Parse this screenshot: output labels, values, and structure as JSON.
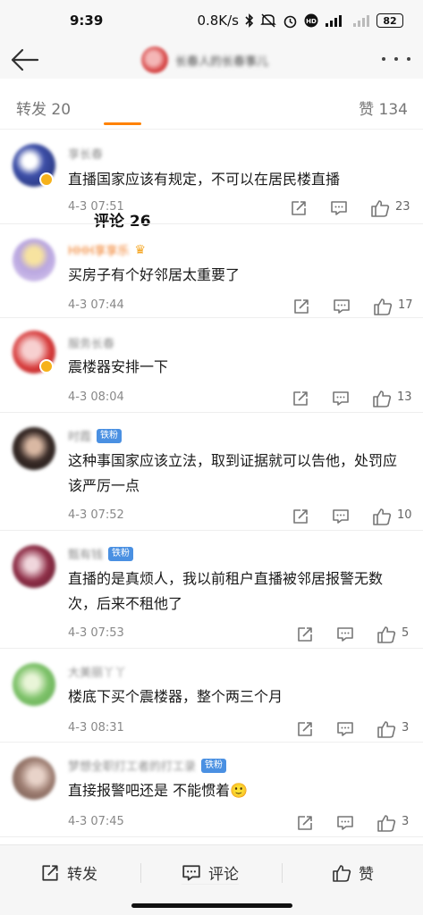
{
  "status_bar": {
    "time": "9:39",
    "net_speed": "0.8K/s",
    "battery": "82",
    "icons": [
      "bluetooth-icon",
      "mute-icon",
      "alarm-icon",
      "hd-icon",
      "signal-icon",
      "wifi-icon",
      "battery-icon"
    ]
  },
  "header": {
    "title": "长春人的长春事儿",
    "back_icon": "back-arrow-icon",
    "more_icon": "more-dots-icon"
  },
  "tabs": {
    "reposts": "转发 20",
    "comments": "评论 26",
    "likes": "赞 134"
  },
  "comments": [
    {
      "username": "享长春",
      "text": "直播国家应该有规定，不可以在居民楼直播",
      "time": "4-3 07:51",
      "likes": "23",
      "verified": true
    },
    {
      "username": "HHH享享乐",
      "text": "买房子有个好邻居太重要了",
      "time": "4-3 07:44",
      "likes": "17"
    },
    {
      "username": "服务长春",
      "text": "震楼器安排一下",
      "time": "4-3 08:04",
      "likes": "13",
      "verified": true
    },
    {
      "username": "时霞",
      "badge": "铁粉",
      "text": "这种事国家应该立法，取到证据就可以告他，处罚应该严厉一点",
      "time": "4-3 07:52",
      "likes": "10"
    },
    {
      "username": "甄有钱",
      "badge": "铁粉",
      "text": "直播的是真烦人，我以前租户直播被邻居报警无数次，后来不租他了",
      "time": "4-3 07:53",
      "likes": "5"
    },
    {
      "username": "大美丽丫丫",
      "text": "楼底下买个震楼器，整个两三个月",
      "time": "4-3 08:31",
      "likes": "3"
    },
    {
      "username": "梦想全职打工者的打工录",
      "badge": "铁粉",
      "text": "直接报警吧还是 不能惯着🙂",
      "time": "4-3 07:45",
      "likes": "3"
    }
  ],
  "bottom_bar": {
    "repost": "转发",
    "comment": "评论",
    "like": "赞"
  },
  "colors": {
    "accent": "#ff8200",
    "badge_blue": "#4a90e2",
    "verified_gold": "#f6b21b"
  }
}
